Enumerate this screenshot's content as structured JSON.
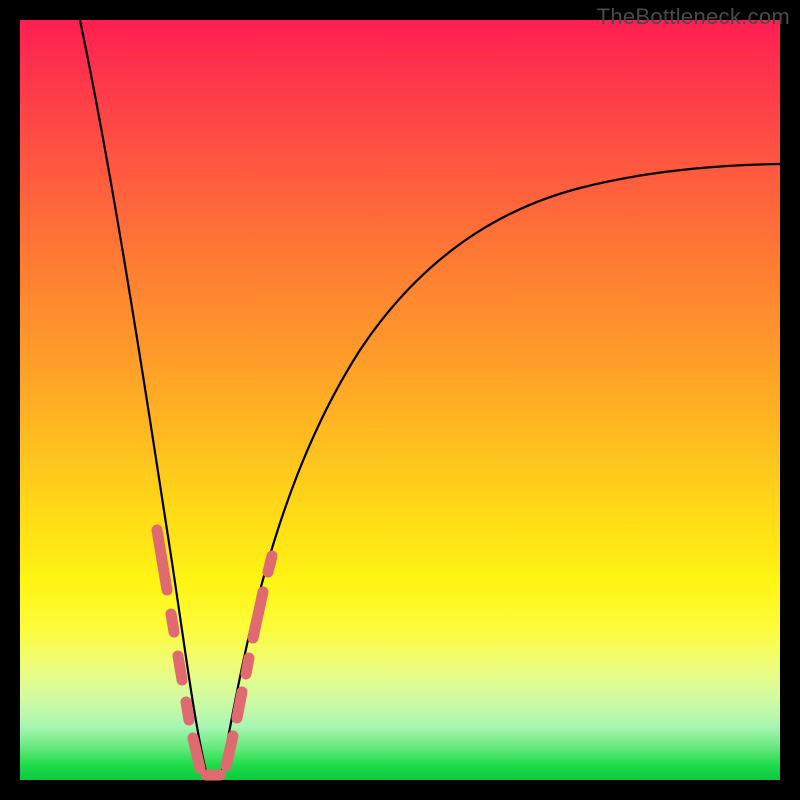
{
  "watermark": "TheBottleneck.com",
  "chart_data": {
    "type": "line",
    "title": "",
    "xlabel": "",
    "ylabel": "",
    "xlim": [
      0,
      100
    ],
    "ylim": [
      0,
      100
    ],
    "grid": false,
    "note": "Bottleneck-style V curve; x≈component balance, y≈bottleneck severity. No axis ticks or numeric labels are rendered in the source image; values are geometric estimates of the drawn curve in normalized 0–100 space.",
    "series": [
      {
        "name": "left-branch",
        "stroke": "#000000",
        "x": [
          8,
          10,
          12,
          14,
          16,
          18,
          19,
          20,
          21,
          22,
          23,
          24
        ],
        "y": [
          100,
          88,
          74,
          60,
          46,
          32,
          24,
          17,
          11,
          6,
          2,
          0
        ]
      },
      {
        "name": "right-branch",
        "stroke": "#000000",
        "x": [
          26,
          27,
          28,
          30,
          32,
          35,
          40,
          45,
          50,
          55,
          60,
          65,
          70,
          75,
          80,
          85,
          90,
          95,
          100
        ],
        "y": [
          0,
          3,
          7,
          15,
          23,
          33,
          45,
          54,
          60,
          65,
          69,
          72,
          74.5,
          76.5,
          78,
          79,
          79.8,
          80.4,
          80.8
        ]
      },
      {
        "name": "valley-marker",
        "stroke": "#e06a6f",
        "marker": "rounded-dash",
        "x": [
          18.2,
          19.4,
          20.4,
          21.3,
          22.0,
          22.8,
          24.0,
          25.5,
          26.8,
          27.8,
          28.8,
          30.0,
          31.4
        ],
        "y": [
          31,
          23,
          16,
          10,
          5,
          2,
          0,
          0,
          3,
          8,
          14,
          21,
          28
        ]
      }
    ],
    "annotations": [
      {
        "text": "TheBottleneck.com",
        "position": "top-right"
      }
    ]
  }
}
